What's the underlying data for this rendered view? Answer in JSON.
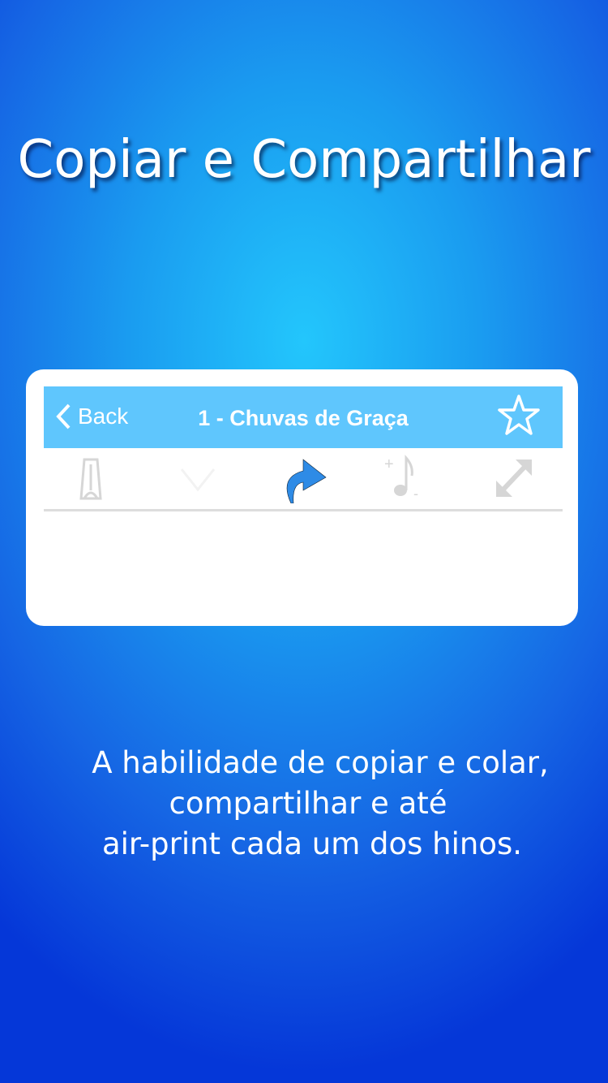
{
  "headline": "Copiar e Compartilhar",
  "card": {
    "nav": {
      "back_label": "Back",
      "title": "1 - Chuvas de Graça",
      "back_icon": "chevron-left-icon",
      "favorite_icon": "star-outline-icon"
    },
    "toolbar": {
      "icons": [
        "metronome-icon",
        "pitch-icon",
        "share-icon",
        "transpose-note-icon",
        "expand-icon"
      ],
      "active_color": "#2e8be6"
    }
  },
  "description": [
    "A habilidade de copiar e colar,",
    "compartilhar e até",
    "air-print cada um dos hinos."
  ]
}
